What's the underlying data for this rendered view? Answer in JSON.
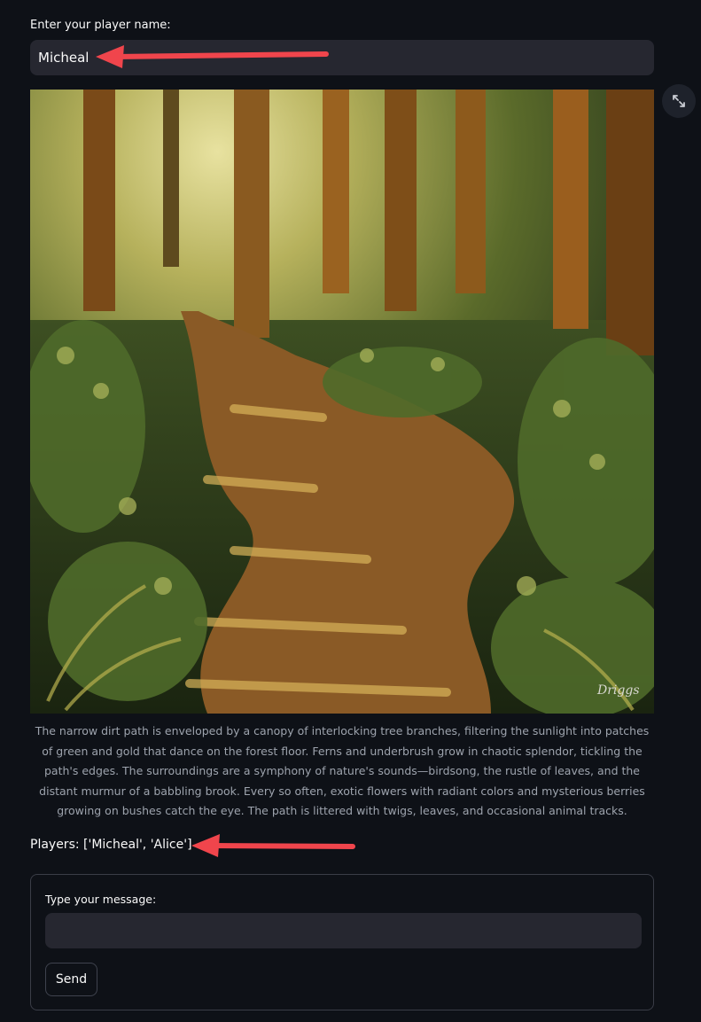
{
  "player_name": {
    "label": "Enter your player name:",
    "value": "Micheal"
  },
  "scene": {
    "caption": "The narrow dirt path is enveloped by a canopy of interlocking tree branches, filtering the sunlight into patches of green and gold that dance on the forest floor. Ferns and underbrush grow in chaotic splendor, tickling the path's edges. The surroundings are a symphony of nature's sounds—birdsong, the rustle of leaves, and the distant murmur of a babbling brook. Every so often, exotic flowers with radiant colors and mysterious berries growing on bushes catch the eye. The path is littered with twigs, leaves, and occasional animal tracks.",
    "signature": "Driggs"
  },
  "players_text": "Players: ['Micheal', 'Alice']",
  "message_form": {
    "label": "Type your message:",
    "value": "",
    "send_label": "Send"
  },
  "icons": {
    "expand": "expand-icon",
    "arrow": "red-arrow-annotation"
  },
  "colors": {
    "background": "#0e1117",
    "input_bg": "#262730",
    "arrow": "#f0454c"
  }
}
